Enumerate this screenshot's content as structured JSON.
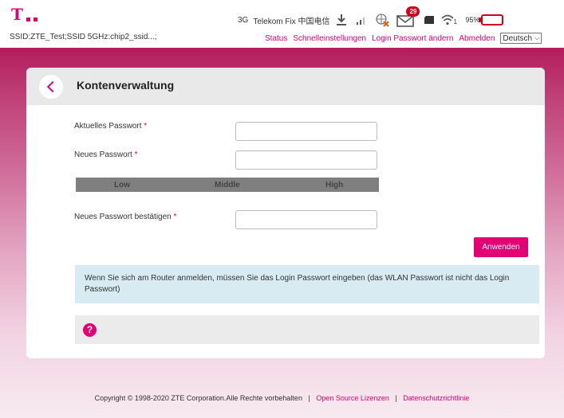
{
  "header": {
    "ssid_text": "SSID:ZTE_Test;SSID 5GHz:chip2_ssid...;",
    "network_type": "3G",
    "provider": "Telekom Fix 中国电信",
    "mail_count": "29",
    "wifi_clients": "1",
    "battery": "95%",
    "accent_color": "#e20074"
  },
  "nav": {
    "status": "Status",
    "quick_settings": "Schnelleinstellungen",
    "change_password": "Login Passwort ändern",
    "logout": "Abmelden",
    "language": "Deutsch"
  },
  "page": {
    "title": "Kontenverwaltung",
    "current_password_label": "Aktuelles Passwort",
    "new_password_label": "Neues Passwort",
    "confirm_password_label": "Neues Passwort bestätigen",
    "required_mark": "*",
    "strength": {
      "low": "Low",
      "middle": "Middle",
      "high": "High"
    },
    "apply_label": "Anwenden",
    "info_text": "Wenn Sie sich am Router anmelden, müssen Sie das Login Passwort eingeben (das WLAN Passwort ist nicht das Login Passwort)",
    "help_glyph": "?"
  },
  "footer": {
    "copyright": "Copyright © 1998-2020 ZTE Corporation.Alle Rechte vorbehalten",
    "separator": "|",
    "open_source": "Open Source Lizenzen",
    "privacy": "Datenschutzrichtlinie"
  }
}
